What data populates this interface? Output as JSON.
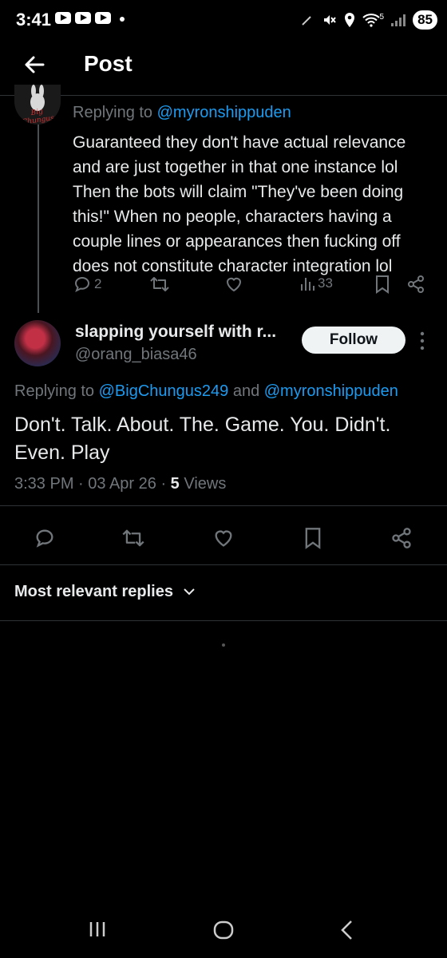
{
  "status_bar": {
    "time": "3:41",
    "battery": "85",
    "wifi_label": "5",
    "icons": [
      "youtube-icon",
      "youtube-icon",
      "youtube-icon",
      "notification-dot",
      "pen-icon",
      "mute-icon",
      "location-icon",
      "wifi-icon",
      "signal-icon",
      "battery-icon"
    ]
  },
  "header": {
    "title": "Post",
    "back_icon": "arrow-left-icon"
  },
  "parent_post": {
    "replying_prefix": "Replying to ",
    "replying_to": "@myronshippuden",
    "avatar_text": "Big Chungus",
    "lines": [
      "Guaranteed they don't have actual relevance",
      "and are just together in that one instance lol",
      "Then the bots will claim \"They've been doing",
      "this!\" When no people, characters having a",
      "couple lines or appearances then fucking off",
      "does not constitute character integration lol"
    ],
    "reply_count": "2",
    "view_count": "33"
  },
  "main_post": {
    "display_name": "slapping yourself with r...",
    "handle": "@orang_biasa46",
    "follow_label": "Follow",
    "replying_prefix": "Replying to ",
    "replying_to_1": "@BigChungus249",
    "replying_and": " and ",
    "replying_to_2": "@myronshippuden",
    "text": "Don't. Talk. About. The. Game. You. Didn't. Even. Play",
    "timestamp": "3:33 PM · 03 Apr 26 · ",
    "views_count": "5",
    "views_label": " Views"
  },
  "replies_sort": {
    "label": "Most relevant replies"
  },
  "colors": {
    "background": "#000000",
    "text": "#e7e9ea",
    "muted": "#71767b",
    "link": "#1d9bf0",
    "divider": "#2f3336"
  }
}
